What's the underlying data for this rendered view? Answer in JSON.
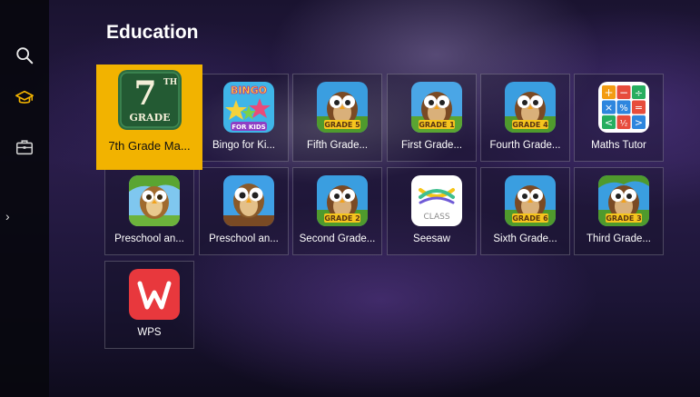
{
  "page": {
    "title": "Education"
  },
  "sidebar": {
    "items": [
      {
        "icon": "search-icon"
      },
      {
        "icon": "graduation-cap-icon",
        "active": true
      },
      {
        "icon": "briefcase-icon"
      }
    ],
    "expand_glyph": "›"
  },
  "apps": [
    {
      "label": "7th Grade Ma...",
      "icon": "grade-7-icon",
      "badge_top": "7",
      "badge_sup": "TH",
      "badge_bottom": "GRADE",
      "selected": true
    },
    {
      "label": "Bingo for Ki...",
      "icon": "bingo-icon",
      "badge_top": "BINGO",
      "badge_bottom": "FOR KIDS"
    },
    {
      "label": "Fifth Grade...",
      "icon": "owl-grade-5-icon",
      "badge_bottom": "GRADE 5"
    },
    {
      "label": "First Grade...",
      "icon": "owl-grade-1-icon",
      "badge_bottom": "GRADE 1"
    },
    {
      "label": "Fourth Grade...",
      "icon": "owl-grade-4-icon",
      "badge_bottom": "GRADE 4"
    },
    {
      "label": "Maths Tutor",
      "icon": "maths-tutor-icon"
    },
    {
      "label": "Preschool an...",
      "icon": "owl-preschool-icon"
    },
    {
      "label": "Preschool an...",
      "icon": "owl-preschool-2-icon"
    },
    {
      "label": "Second Grade...",
      "icon": "owl-grade-2-icon",
      "badge_bottom": "GRADE 2"
    },
    {
      "label": "Seesaw",
      "icon": "seesaw-icon",
      "badge_bottom": "CLASS"
    },
    {
      "label": "Sixth Grade...",
      "icon": "owl-grade-6-icon",
      "badge_bottom": "GRADE 6"
    },
    {
      "label": "Third Grade...",
      "icon": "owl-grade-3-icon",
      "badge_bottom": "GRADE 3"
    },
    {
      "label": "WPS",
      "icon": "wps-icon"
    }
  ],
  "colors": {
    "selected_tile": "#f2b300",
    "accent": "#f2b300",
    "maths_orange": "#f39c12",
    "maths_red": "#e74c3c",
    "maths_green": "#27ae60",
    "maths_blue": "#2e86de",
    "wps_red": "#e8383d"
  }
}
